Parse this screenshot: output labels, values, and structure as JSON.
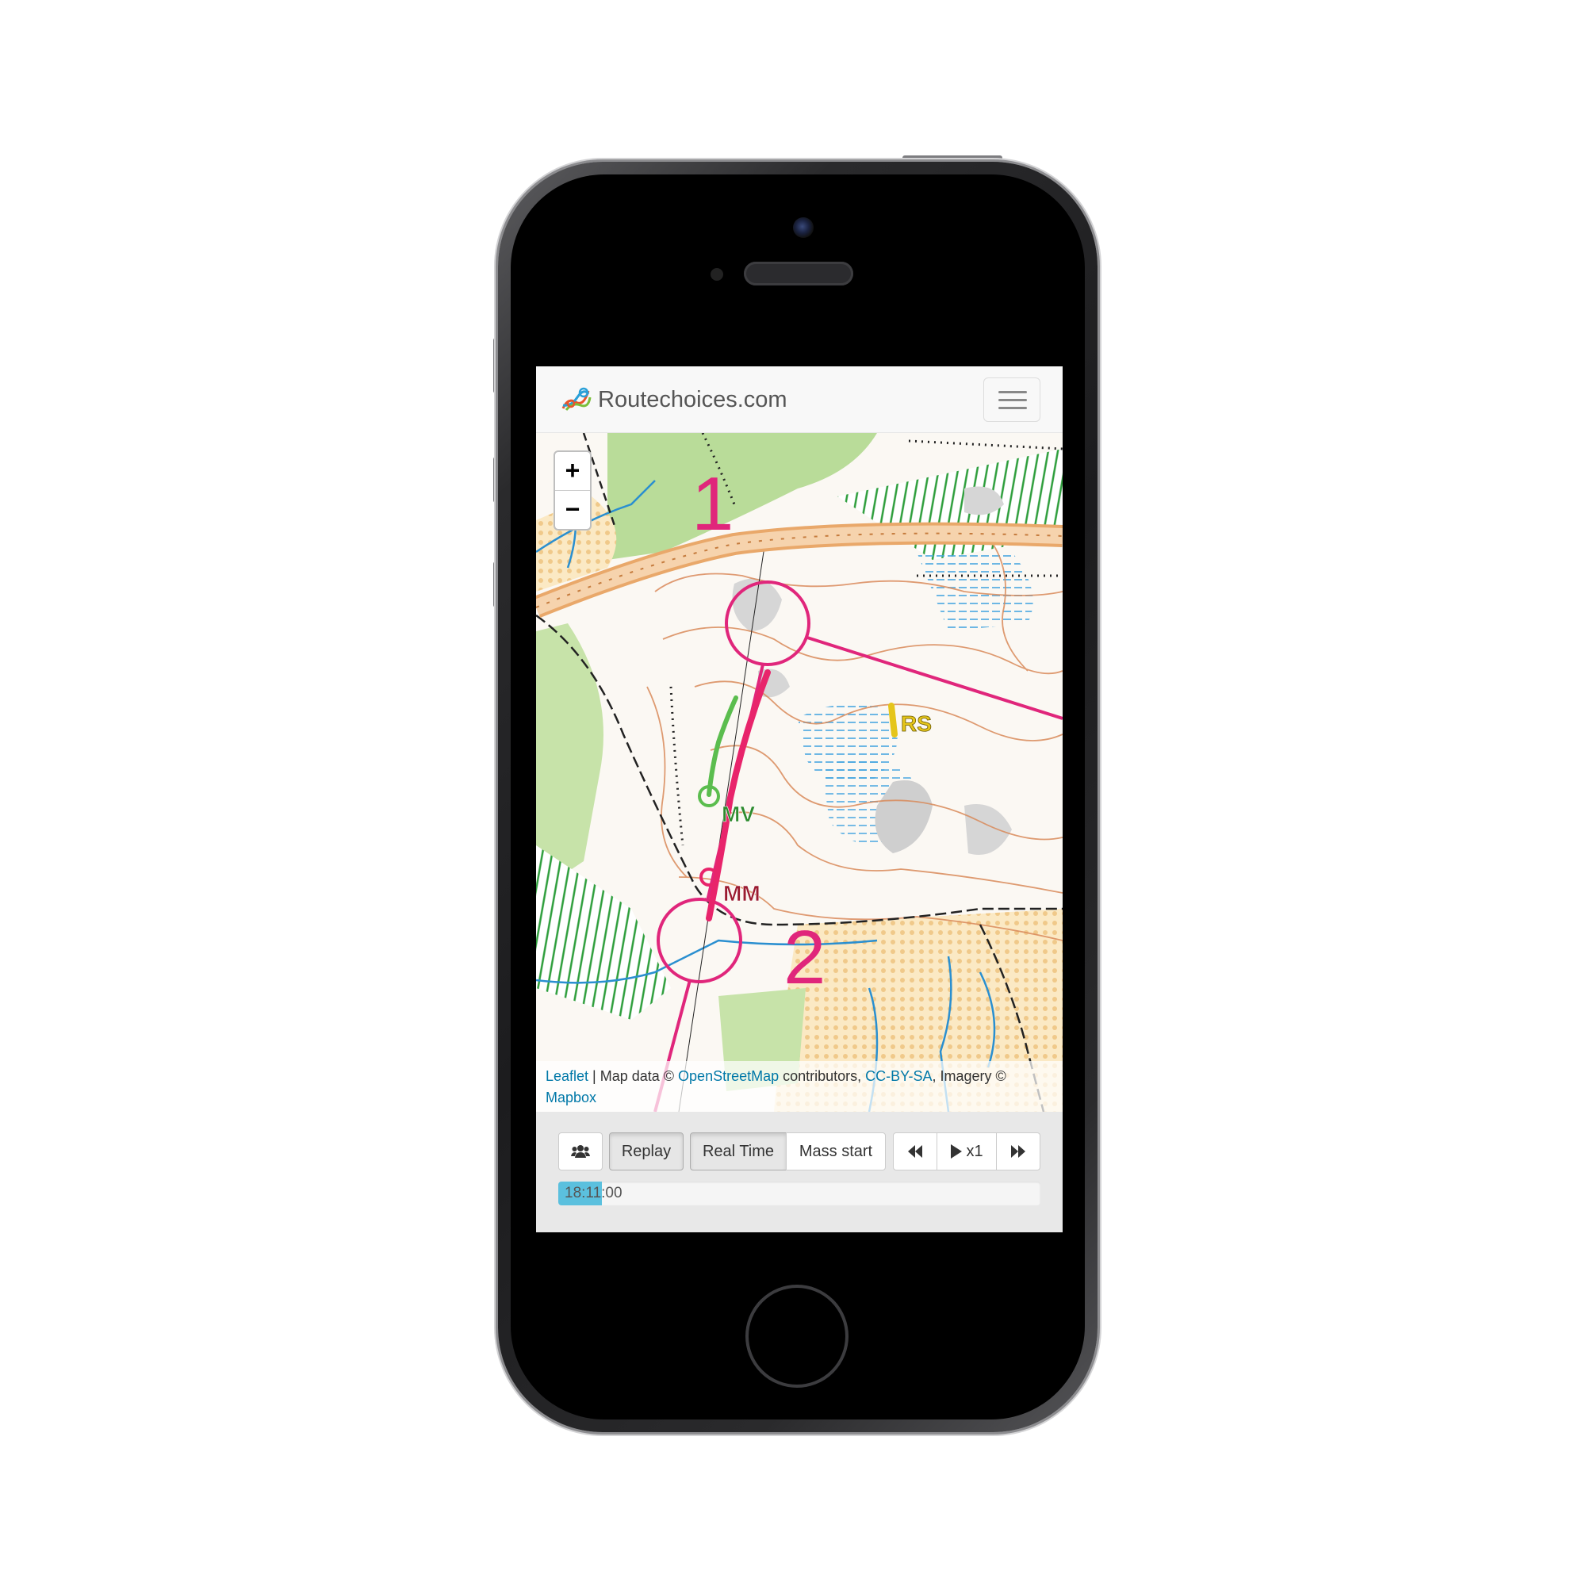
{
  "app": {
    "brand_name": "Routechoices.com",
    "logo_icon": "routechoices-logo-icon",
    "menu_icon": "hamburger-menu-icon"
  },
  "map": {
    "zoom_in_label": "+",
    "zoom_out_label": "−",
    "control_labels": [
      "1",
      "2"
    ],
    "runners": [
      {
        "initials": "MV",
        "color": "#2e8b2e"
      },
      {
        "initials": "MM",
        "color": "#9b1b30"
      },
      {
        "initials": "RS",
        "color": "#e5c51a"
      }
    ],
    "attribution": {
      "leaflet": "Leaflet",
      "sep1": " | Map data © ",
      "osm": "OpenStreetMap",
      "sep2": " contributors, ",
      "license": "CC-BY-SA",
      "sep3": ", Imagery © ",
      "mapbox": "Mapbox"
    }
  },
  "controls": {
    "competitors_icon": "users-icon",
    "replay_label": "Replay",
    "realtime_label": "Real Time",
    "massstart_label": "Mass start",
    "rewind_icon": "fast-backward-icon",
    "play_label": "x1",
    "play_icon": "play-icon",
    "forward_icon": "fast-forward-icon",
    "time": "18:11:00",
    "progress_fraction": 0.09
  },
  "colors": {
    "course": "#e0267b",
    "link": "#0078a8",
    "progress": "#5bc0de"
  }
}
